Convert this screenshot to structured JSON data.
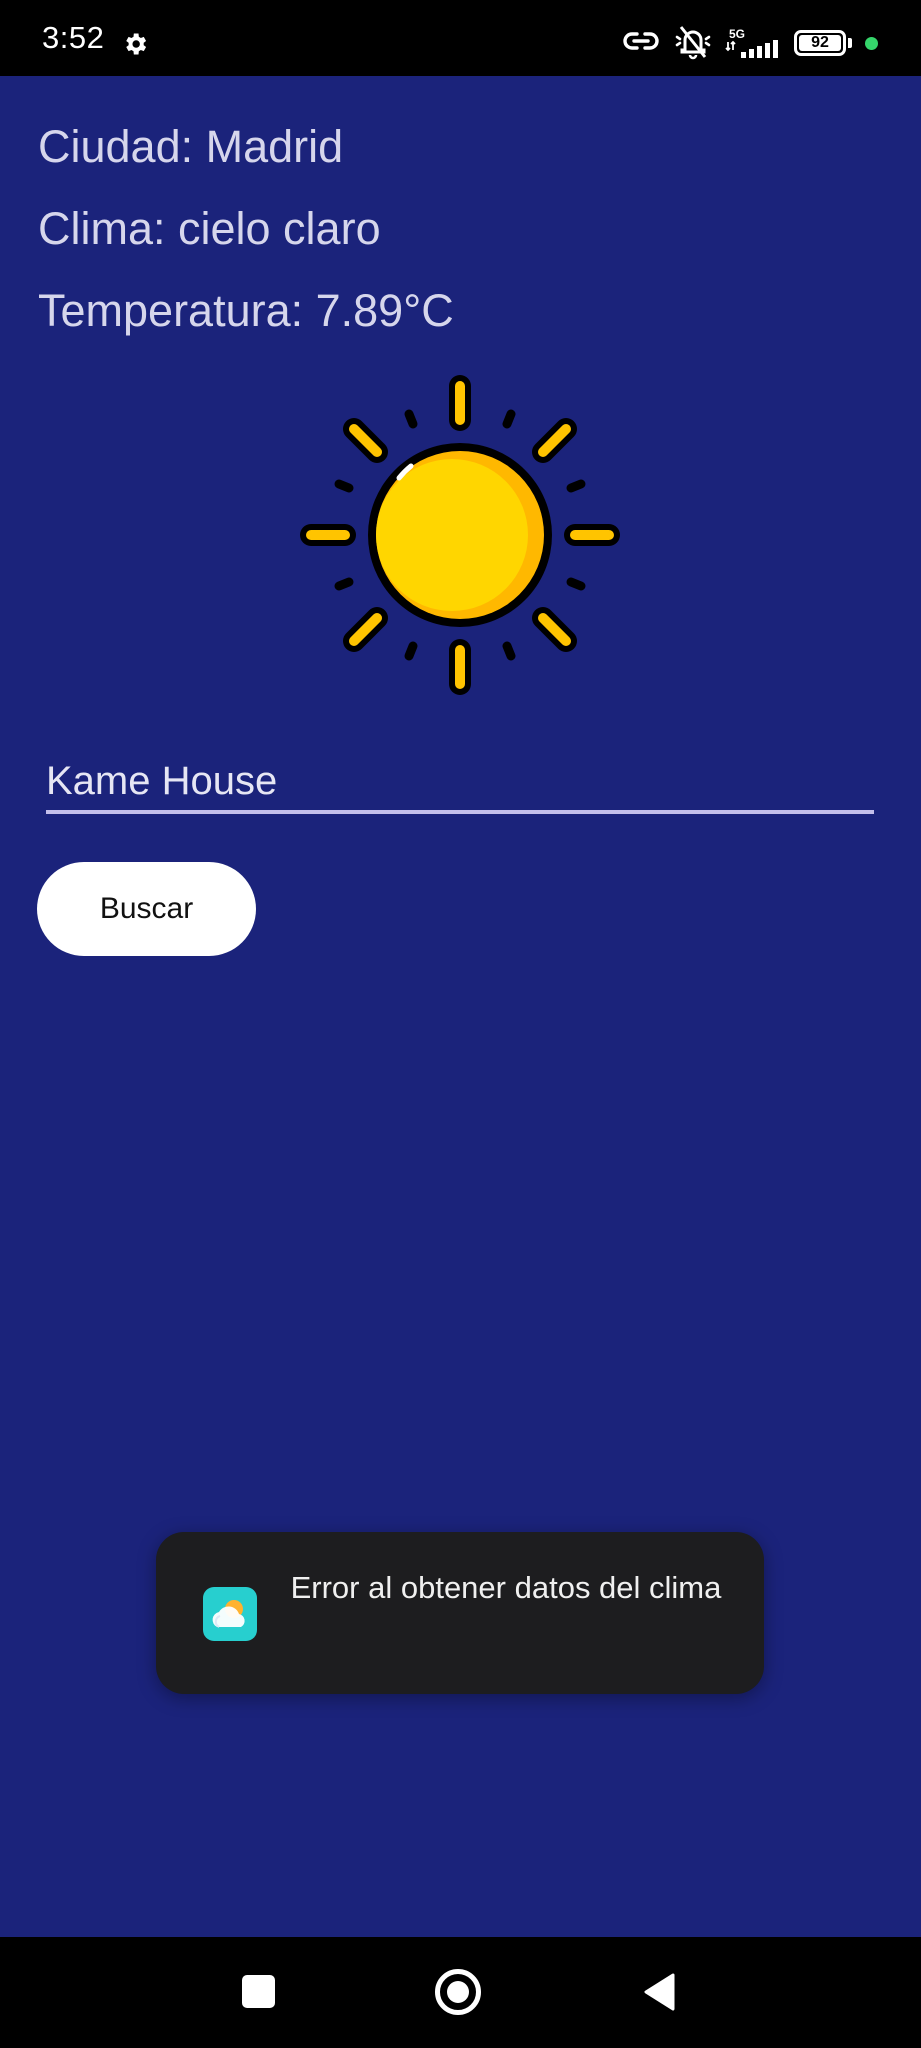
{
  "status_bar": {
    "time": "3:52",
    "network_label": "5G",
    "battery_level": "92",
    "icons": [
      "gear-icon",
      "link-icon",
      "silent-bell-icon",
      "signal-icon",
      "battery-icon",
      "green-dot-indicator"
    ]
  },
  "weather_info": {
    "city": "Ciudad: Madrid",
    "condition": "Clima: cielo claro",
    "temperature": "Temperatura: 7.89°C",
    "weather_icon": "sun-icon"
  },
  "search": {
    "input_value": "Kame House",
    "button_label": "Buscar"
  },
  "toast": {
    "message": "Error al obtener datos del clima",
    "app_icon": "weather-app-icon"
  },
  "nav_bar": {
    "buttons": [
      "recents-button",
      "home-button",
      "back-button"
    ]
  },
  "colors": {
    "background": "#1b237b",
    "text": "#d6d6ec",
    "input_underline": "#c4bfeb",
    "sun_yellow": "#ffd600",
    "sun_shade": "#ffb800",
    "toast_background": "#1d1d1f",
    "app_icon": "#27cfcf",
    "status_dot": "#35d56b"
  }
}
